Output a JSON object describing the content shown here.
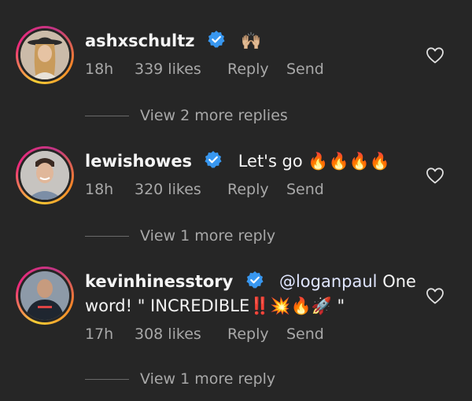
{
  "comments": [
    {
      "username": "ashxschultz",
      "text": "🙌🏼",
      "text_line2": "",
      "time": "18h",
      "likes": "339 likes",
      "reply_label": "Reply",
      "send_label": "Send",
      "view_replies": "View 2 more replies"
    },
    {
      "username": "lewishowes",
      "text": "Let's go 🔥🔥🔥🔥",
      "text_line2": "",
      "time": "18h",
      "likes": "320 likes",
      "reply_label": "Reply",
      "send_label": "Send",
      "view_replies": "View 1 more reply"
    },
    {
      "username": "kevinhinesstory",
      "mention": "@loganpaul",
      "text": "One",
      "text_line2": "word!  \" INCREDIBLE‼️💥🔥🚀 \"",
      "time": "17h",
      "likes": "308 likes",
      "reply_label": "Reply",
      "send_label": "Send",
      "view_replies": "View 1 more reply"
    }
  ],
  "colors": {
    "background": "#262626",
    "verified": "#3897f0",
    "muted": "#a8a8a8"
  },
  "icons": {
    "verified": "verified-badge-icon",
    "like": "heart-outline-icon"
  }
}
